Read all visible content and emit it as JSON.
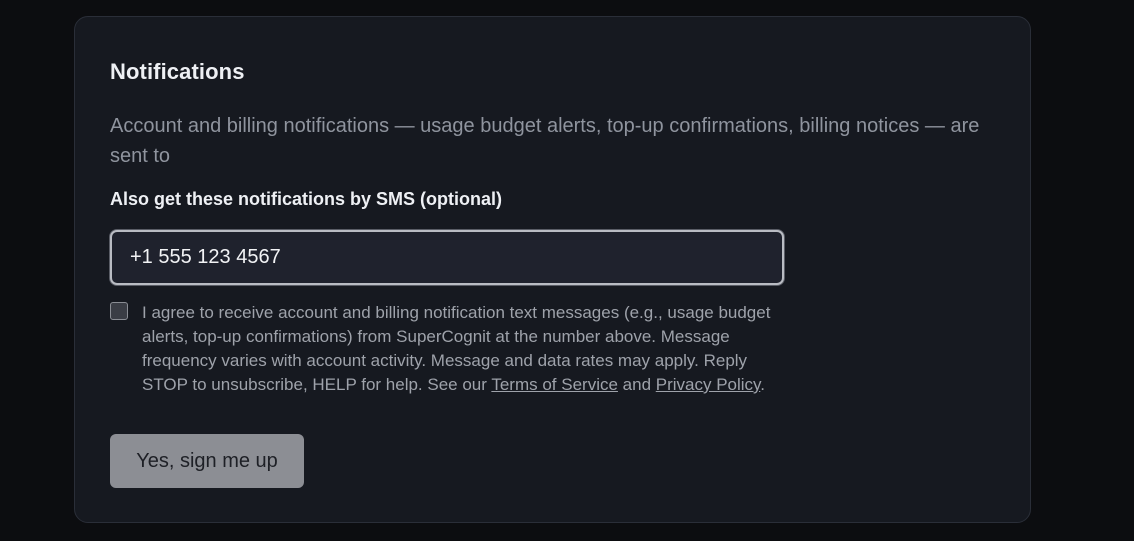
{
  "notifications": {
    "title": "Notifications",
    "description": "Account and billing notifications — usage budget alerts, top-up confirmations, billing notices — are sent to",
    "sms_label": "Also get these notifications by SMS (optional)",
    "phone_value": "+1 555 123 4567",
    "consent": {
      "checked": false,
      "text_before": "I agree to receive account and billing notification text messages (e.g., usage budget alerts, top-up confirmations) from SuperCognit at the number above. Message frequency varies with account activity. Message and data rates may apply. Reply STOP to unsubscribe, HELP for help. See our ",
      "terms_link": "Terms of Service",
      "text_middle": " and ",
      "privacy_link": "Privacy Policy",
      "text_after": "."
    },
    "submit_label": "Yes, sign me up"
  },
  "colors": {
    "page_bg": "#0c0d10",
    "card_bg": "#161920",
    "button_bg": "#8c8e94"
  }
}
